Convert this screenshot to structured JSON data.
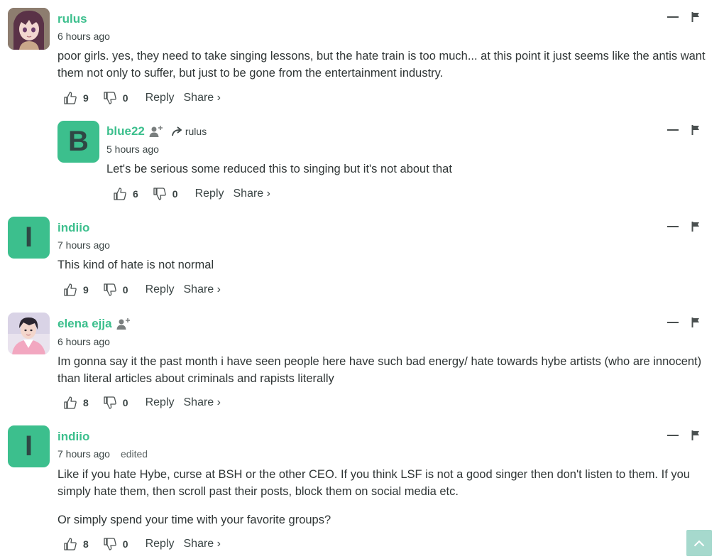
{
  "comments": [
    {
      "author": "rulus",
      "time": "6 hours ago",
      "avatar": {
        "type": "image",
        "icon": "anime-girl-avatar"
      },
      "paragraphs": [
        "poor girls. yes, they need to take singing lessons, but the hate train is too much... at this point it just seems like the antis want them not only to suffer, but just to be gone from the entertainment industry."
      ],
      "likes": "9",
      "dislikes": "0"
    },
    {
      "author": "blue22",
      "time": "5 hours ago",
      "avatar": {
        "type": "letter",
        "letter": "B"
      },
      "reply_to": "rulus",
      "paragraphs": [
        "Let's be serious some reduced this to singing but it's not about that"
      ],
      "likes": "6",
      "dislikes": "0"
    },
    {
      "author": "indiio",
      "time": "7 hours ago",
      "avatar": {
        "type": "letter",
        "letter": "I"
      },
      "paragraphs": [
        "This kind of hate is not normal"
      ],
      "likes": "9",
      "dislikes": "0"
    },
    {
      "author": "elena ejja",
      "time": "6 hours ago",
      "avatar": {
        "type": "image",
        "icon": "person-photo-avatar"
      },
      "paragraphs": [
        "Im gonna say it the past month i have seen people here have such bad energy/ hate towards hybe artists (who are innocent) than literal articles about criminals and rapists literally"
      ],
      "likes": "8",
      "dislikes": "0"
    },
    {
      "author": "indiio",
      "time": "7 hours ago",
      "edited": "edited",
      "avatar": {
        "type": "letter",
        "letter": "I"
      },
      "paragraphs": [
        "Like if you hate Hybe, curse at BSH or the other CEO. If you think LSF is not a good singer then don't listen to them. If you simply hate them, then scroll past their posts, block them on social media etc.",
        "Or simply spend your time with your favorite groups?"
      ],
      "likes": "8",
      "dislikes": "0"
    }
  ],
  "labels": {
    "reply": "Reply",
    "share": "Share ›"
  },
  "colors": {
    "accent": "#3cbf8d",
    "text": "#2f3535",
    "scroll_button": "#a6d9cd"
  }
}
